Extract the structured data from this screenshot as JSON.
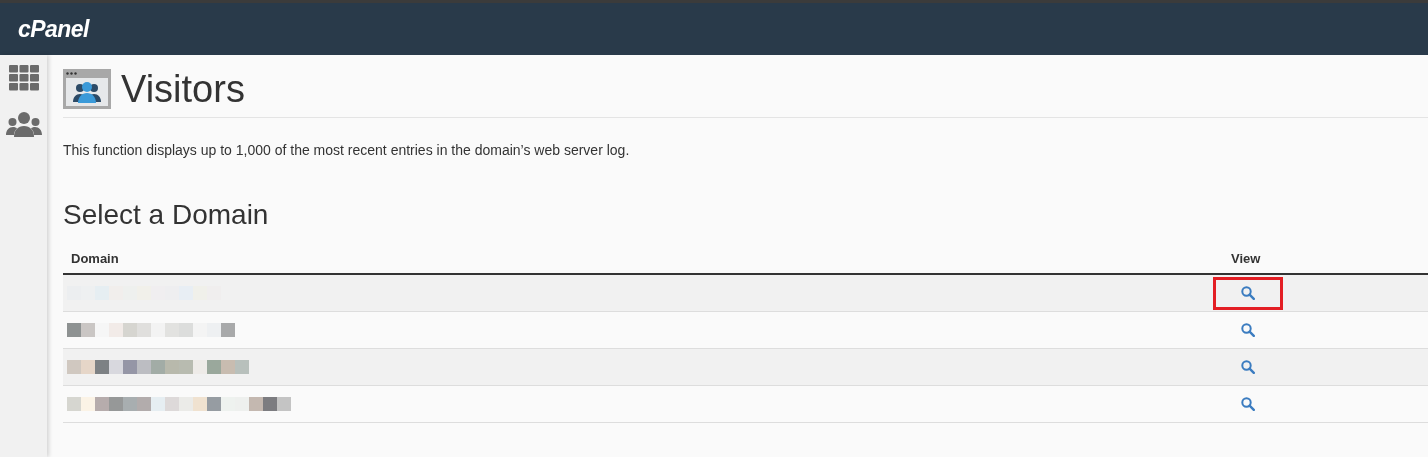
{
  "header": {
    "logo": "cPanel"
  },
  "sidebar": {
    "items": [
      {
        "kind": "apps"
      },
      {
        "kind": "users"
      }
    ]
  },
  "page": {
    "title": "Visitors",
    "description": "This function displays up to 1,000 of the most recent entries in the domain’s web server log."
  },
  "section": {
    "title": "Select a Domain"
  },
  "table": {
    "columns": [
      "Domain",
      "View"
    ],
    "rows": [
      {
        "highlighted": true
      },
      {
        "highlighted": false
      },
      {
        "highlighted": false
      },
      {
        "highlighted": false
      }
    ]
  }
}
